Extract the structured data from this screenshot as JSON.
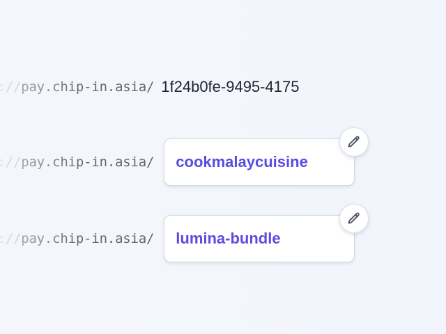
{
  "links": [
    {
      "prefix_scheme": "ps://",
      "prefix_host": "pay.chip-in.asia/",
      "slug": "1f24b0fe-9495-4175",
      "editable": false
    },
    {
      "prefix_scheme": "ps://",
      "prefix_host": "pay.chip-in.asia/",
      "slug": "cookmalaycuisine",
      "editable": true,
      "edit_icon": "pencil-icon"
    },
    {
      "prefix_scheme": "ps://",
      "prefix_host": "pay.chip-in.asia/",
      "slug": "lumina-bundle",
      "editable": true,
      "edit_icon": "pencil-icon"
    }
  ],
  "colors": {
    "slug_accent": "#5b4be0",
    "prefix_text": "#5f6878",
    "prefix_faded": "#b3b9c6",
    "static_id_text": "#1f2433",
    "background": "#f2f5fb"
  }
}
